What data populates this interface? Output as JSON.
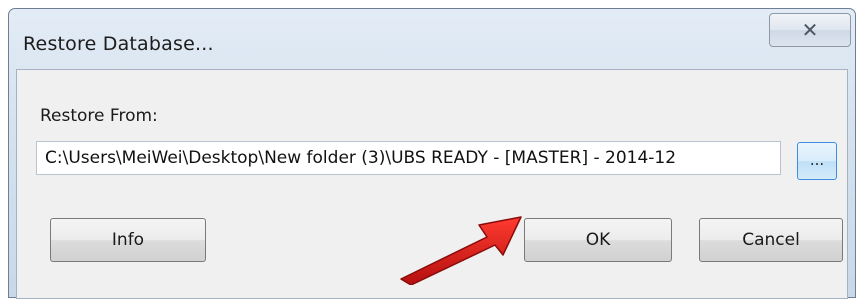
{
  "window": {
    "title": "Restore Database...",
    "close_glyph": "✕"
  },
  "form": {
    "restore_from_label": "Restore From:",
    "path_value": "C:\\Users\\MeiWei\\Desktop\\New folder (3)\\UBS READY - [MASTER] - 2014-12",
    "browse_label": "..."
  },
  "buttons": {
    "info_label": "Info",
    "ok_label": "OK",
    "cancel_label": "Cancel"
  },
  "annotation": {
    "arrow_color": "#e02020",
    "arrow_target": "ok-button"
  },
  "colors": {
    "titlebar": "#d6e2ef",
    "client": "#f0f0f0",
    "browse_highlight": "#3d8ee0"
  }
}
